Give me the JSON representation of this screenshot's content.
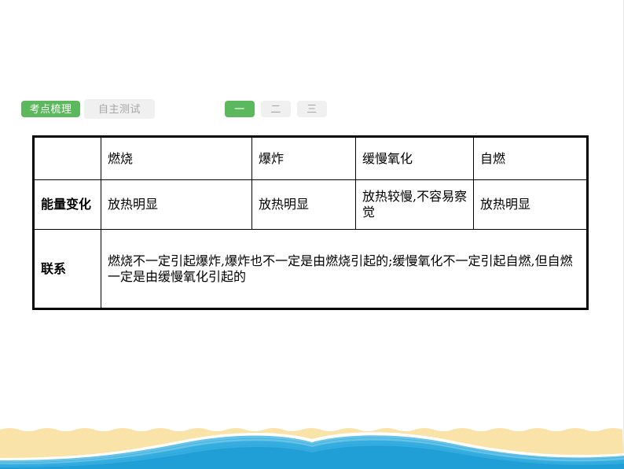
{
  "tabs": {
    "primary": [
      {
        "label": "考点梳理",
        "state": "active"
      },
      {
        "label": "自主测试",
        "state": "idle"
      }
    ],
    "numbered": [
      {
        "label": "一",
        "state": "active"
      },
      {
        "label": "二",
        "state": "idle"
      },
      {
        "label": "三",
        "state": "idle"
      }
    ]
  },
  "table": {
    "headers": [
      "",
      "燃烧",
      "爆炸",
      "缓慢氧化",
      "自燃"
    ],
    "rows": [
      {
        "head": "能量变化",
        "cells": [
          "放热明显",
          "放热明显",
          "放热较慢,不容易察觉",
          "放热明显"
        ]
      },
      {
        "head": "联系",
        "span_text": "燃烧不一定引起爆炸,爆炸也不一定是由燃烧引起的;缓慢氧化不一定引起自燃,但自燃一定是由缓慢氧化引起的"
      }
    ]
  },
  "colors": {
    "accent_green": "#5cb85c",
    "idle_gray_bg": "#f0f0f0",
    "idle_gray_text": "#a6a6a6",
    "sand": "#fae3a8",
    "wave_light": "#66c3e8",
    "wave_mid": "#35ade0",
    "wave_dark": "#1f9fd6"
  }
}
